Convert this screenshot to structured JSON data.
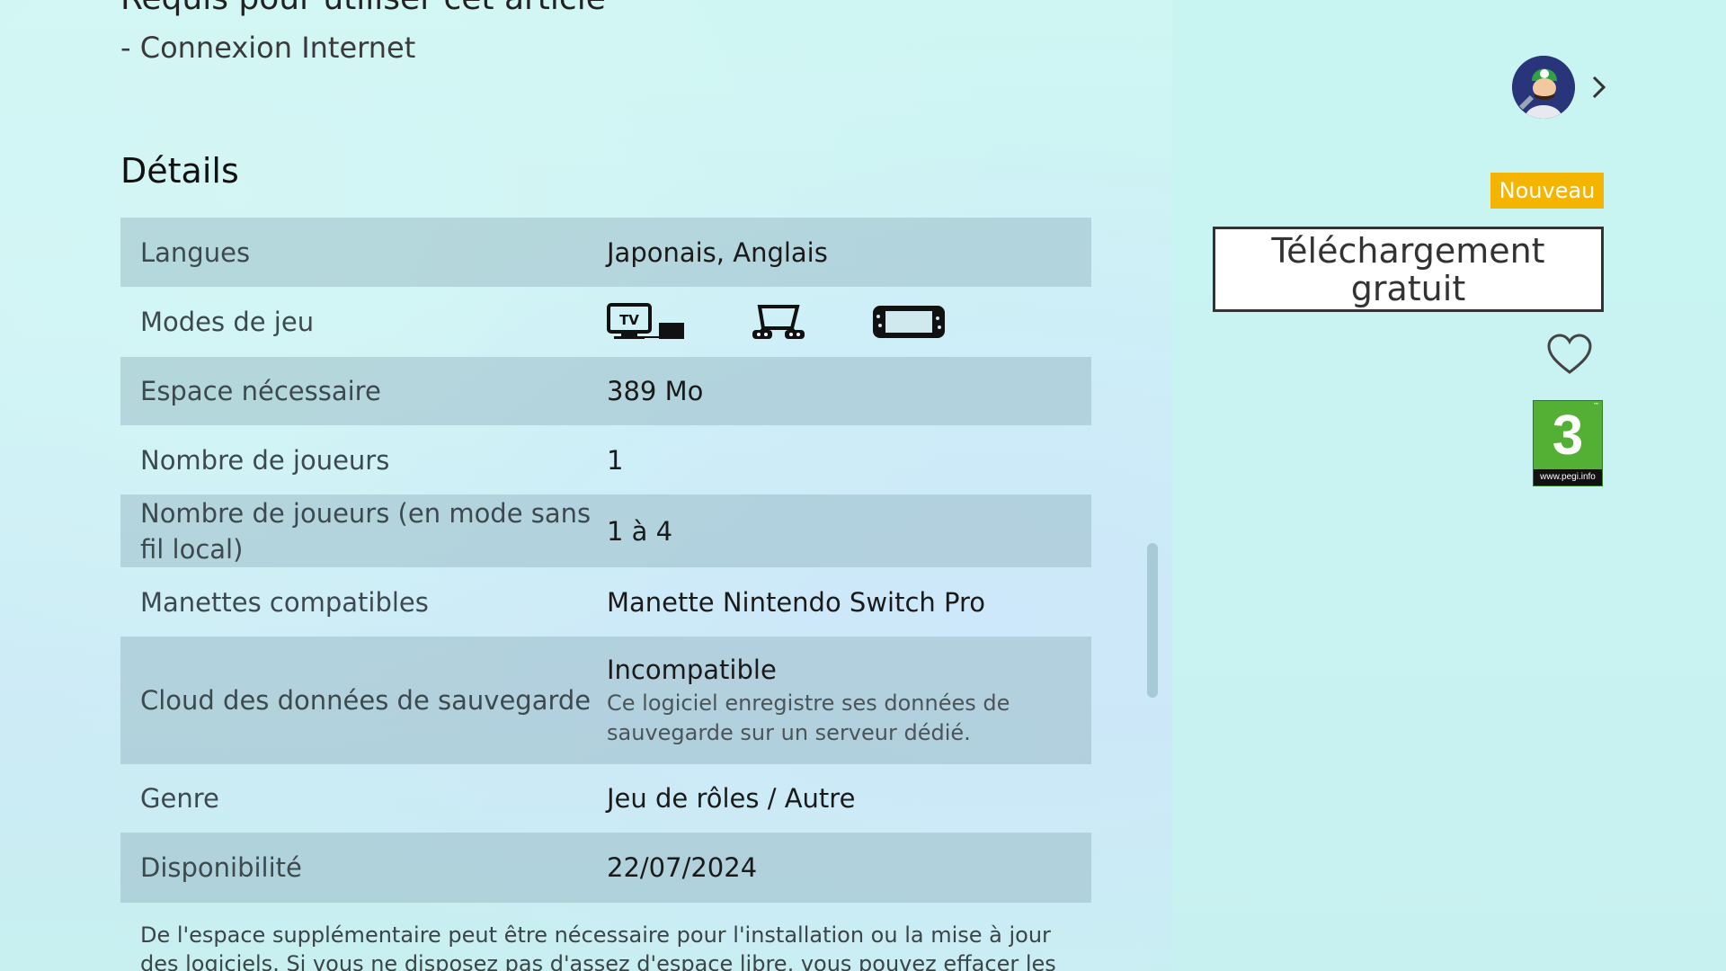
{
  "requirements": {
    "title": "Requis pour utiliser cet article",
    "items": [
      "- Connexion Internet"
    ]
  },
  "details": {
    "title": "Détails",
    "rows": {
      "languages": {
        "label": "Langues",
        "value": "Japonais, Anglais"
      },
      "play_modes": {
        "label": "Modes de jeu",
        "icons": [
          "tv-mode-icon",
          "tabletop-mode-icon",
          "handheld-mode-icon"
        ]
      },
      "space": {
        "label": "Espace nécessaire",
        "value": "389 Mo"
      },
      "players": {
        "label": "Nombre de joueurs",
        "value": "1"
      },
      "players_local_wireless": {
        "label": "Nombre de joueurs (en mode sans fil local)",
        "value": "1 à 4"
      },
      "controllers": {
        "label": "Manettes compatibles",
        "value": "Manette Nintendo Switch Pro"
      },
      "cloud_save": {
        "label": "Cloud des données de sauvegarde",
        "value": "Incompatible",
        "note": "Ce logiciel enregistre ses données de sauvegarde sur un serveur dédié."
      },
      "genre": {
        "label": "Genre",
        "value": "Jeu de rôles / Autre"
      },
      "availability": {
        "label": "Disponibilité",
        "value": "22/07/2024"
      }
    },
    "footnote": "De l'espace supplémentaire peut être nécessaire pour l'installation ou la mise à jour des logiciels. Si vous ne disposez pas d'assez d'espace libre, vous pouvez effacer les logiciels"
  },
  "sidebar": {
    "badge": "Nouveau",
    "download_label": "Téléchargement gratuit",
    "rating": {
      "number": "3",
      "url": "www.pegi.info",
      "tm": "™"
    }
  },
  "colors": {
    "badge_bg": "#f5b400",
    "pegi_green": "#54b034",
    "row_shade": "rgba(140,175,185,0.42)"
  }
}
